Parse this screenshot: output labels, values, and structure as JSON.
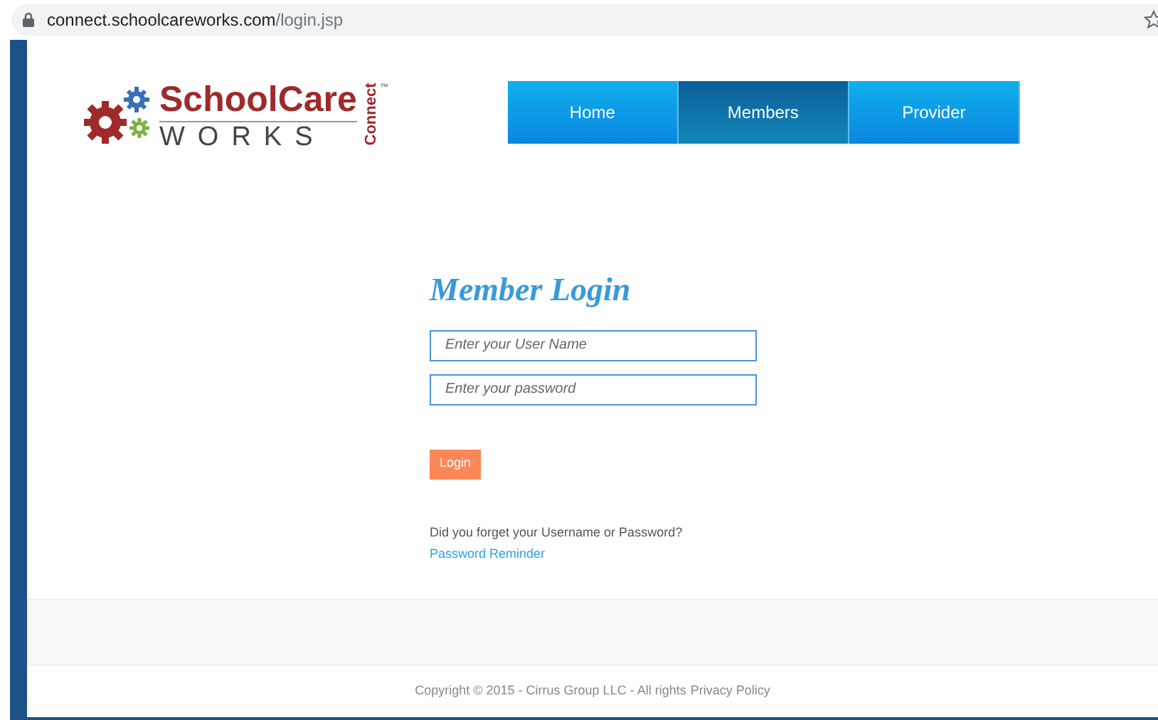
{
  "address_bar": {
    "host": "connect.schoolcareworks.com",
    "path": "/login.jsp"
  },
  "logo": {
    "name": "SchoolCare",
    "subtitle": "WORKS",
    "tag": "Connect",
    "trademark": "™"
  },
  "nav": [
    {
      "label": "Home",
      "selected": false
    },
    {
      "label": "Members",
      "selected": true
    },
    {
      "label": "Provider",
      "selected": false
    }
  ],
  "login": {
    "title": "Member Login",
    "fields": [
      {
        "placeholder": "Enter your User Name"
      },
      {
        "placeholder": "Enter your password"
      }
    ],
    "button": "Login",
    "help_text": "Did you forget your Username or Password?",
    "help_link": "Password Reminder"
  },
  "footer": {
    "copyright": "Copyright © 2015 - Cirrus Group LLC - All rights",
    "link": "Privacy Policy"
  }
}
